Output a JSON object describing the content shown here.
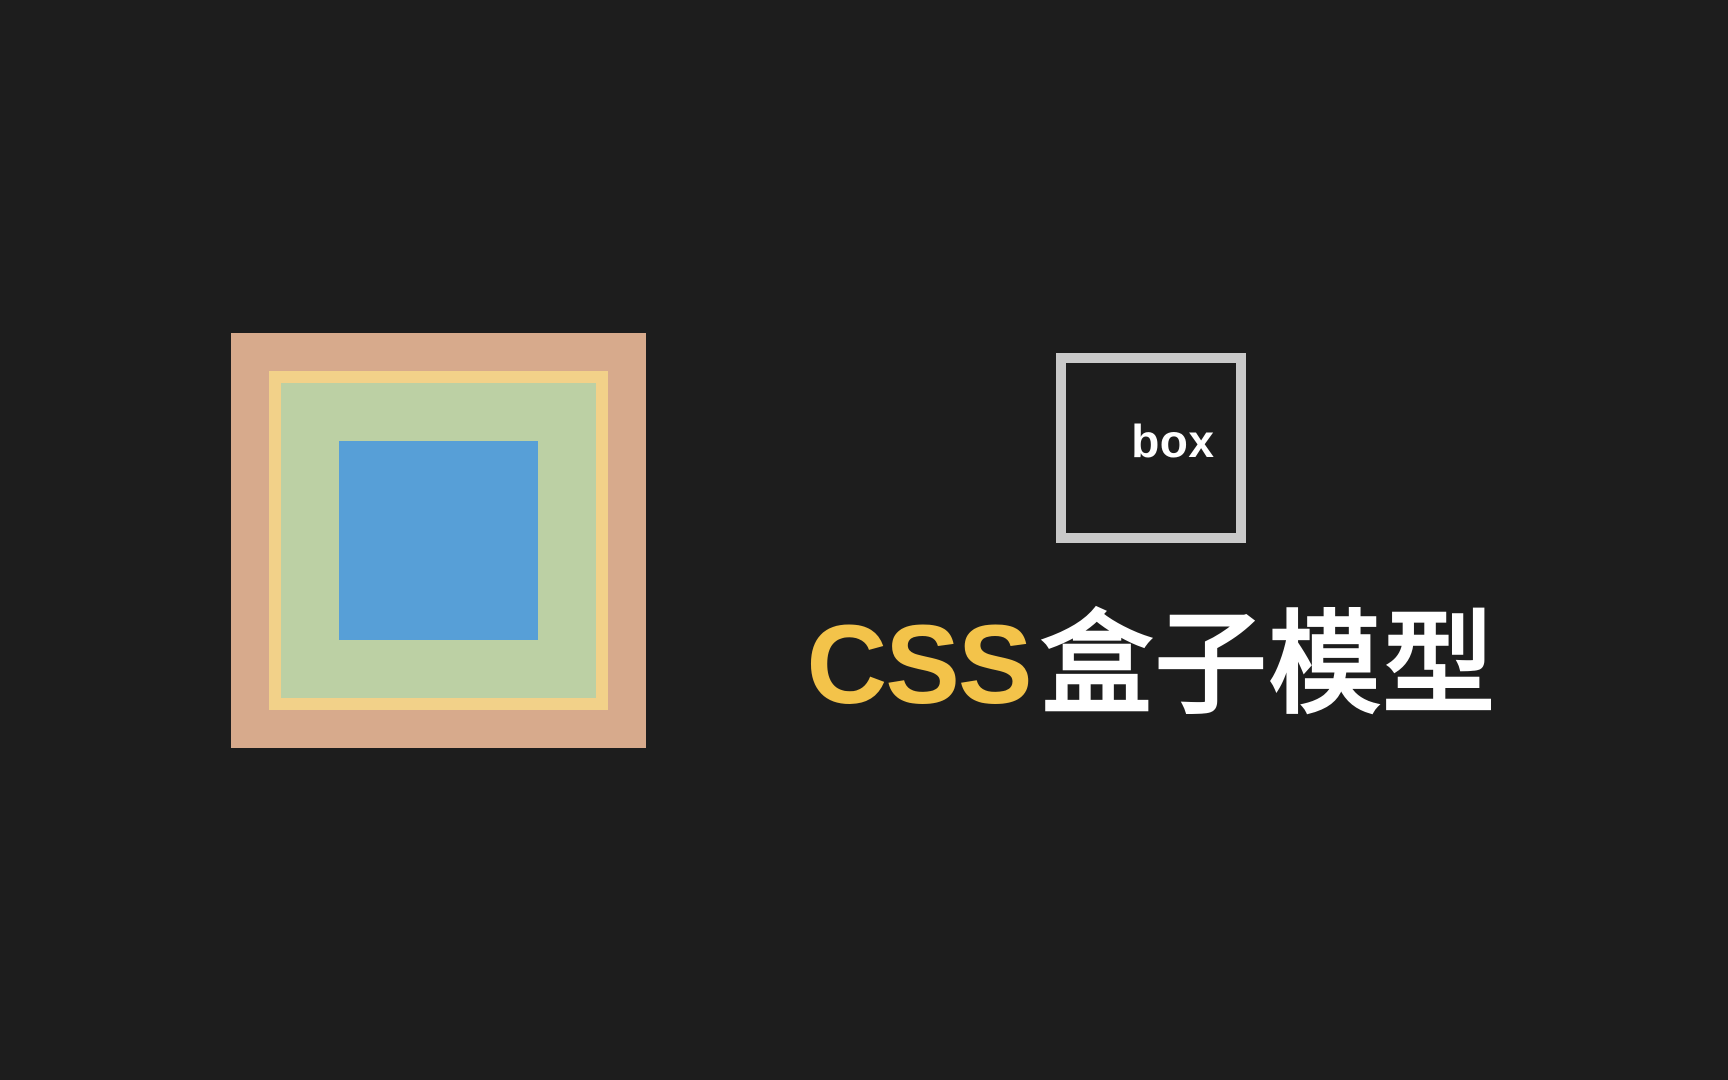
{
  "box_icon": {
    "label": "box"
  },
  "title": {
    "css": "CSS",
    "cn": "盒子模型"
  },
  "box_model": {
    "layers": [
      "margin",
      "border",
      "padding",
      "content"
    ],
    "colors": {
      "margin": "#d7aa8c",
      "border": "#f2d189",
      "padding": "#bcd0a4",
      "content": "#579fd7"
    }
  }
}
